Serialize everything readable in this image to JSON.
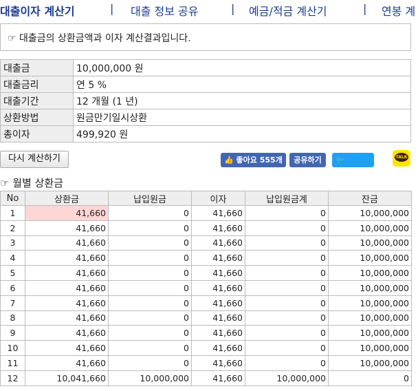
{
  "nav": {
    "items": [
      "대출이자 계산기",
      "대출 정보 공유",
      "예금/적금 계산기",
      "연봉 계"
    ],
    "separator": "|"
  },
  "notice": {
    "text": "☞ 대출금의 상환금액과 이자 계산결과입니다."
  },
  "info": [
    {
      "label": "대출금",
      "value": "10,000,000 원"
    },
    {
      "label": "대출금리",
      "value": "연 5 %"
    },
    {
      "label": "대출기간",
      "value": "12 개월 (1 년)"
    },
    {
      "label": "상환방법",
      "value": "원금만기일시상환"
    },
    {
      "label": "총이자",
      "value": "499,920 원"
    }
  ],
  "buttons": {
    "recalc": "다시 계산하기",
    "like": "좋아요 555개",
    "share": "공유하기",
    "tweet": "Tweet",
    "kakao": "TALK"
  },
  "colors": {
    "like": "#4267b2",
    "twitter": "#1da1f2",
    "kakao": "#fee500",
    "highlight": "#ffd6d6"
  },
  "schedule": {
    "title": "☞ 월별 상환금",
    "headers": [
      "No",
      "상환금",
      "납입원금",
      "이자",
      "납입원금계",
      "잔금"
    ],
    "rows": [
      [
        "1",
        "41,660",
        "0",
        "41,660",
        "0",
        "10,000,000"
      ],
      [
        "2",
        "41,660",
        "0",
        "41,660",
        "0",
        "10,000,000"
      ],
      [
        "3",
        "41,660",
        "0",
        "41,660",
        "0",
        "10,000,000"
      ],
      [
        "4",
        "41,660",
        "0",
        "41,660",
        "0",
        "10,000,000"
      ],
      [
        "5",
        "41,660",
        "0",
        "41,660",
        "0",
        "10,000,000"
      ],
      [
        "6",
        "41,660",
        "0",
        "41,660",
        "0",
        "10,000,000"
      ],
      [
        "7",
        "41,660",
        "0",
        "41,660",
        "0",
        "10,000,000"
      ],
      [
        "8",
        "41,660",
        "0",
        "41,660",
        "0",
        "10,000,000"
      ],
      [
        "9",
        "41,660",
        "0",
        "41,660",
        "0",
        "10,000,000"
      ],
      [
        "10",
        "41,660",
        "0",
        "41,660",
        "0",
        "10,000,000"
      ],
      [
        "11",
        "41,660",
        "0",
        "41,660",
        "0",
        "10,000,000"
      ],
      [
        "12",
        "10,041,660",
        "10,000,000",
        "41,660",
        "10,000,000",
        "0"
      ]
    ]
  }
}
